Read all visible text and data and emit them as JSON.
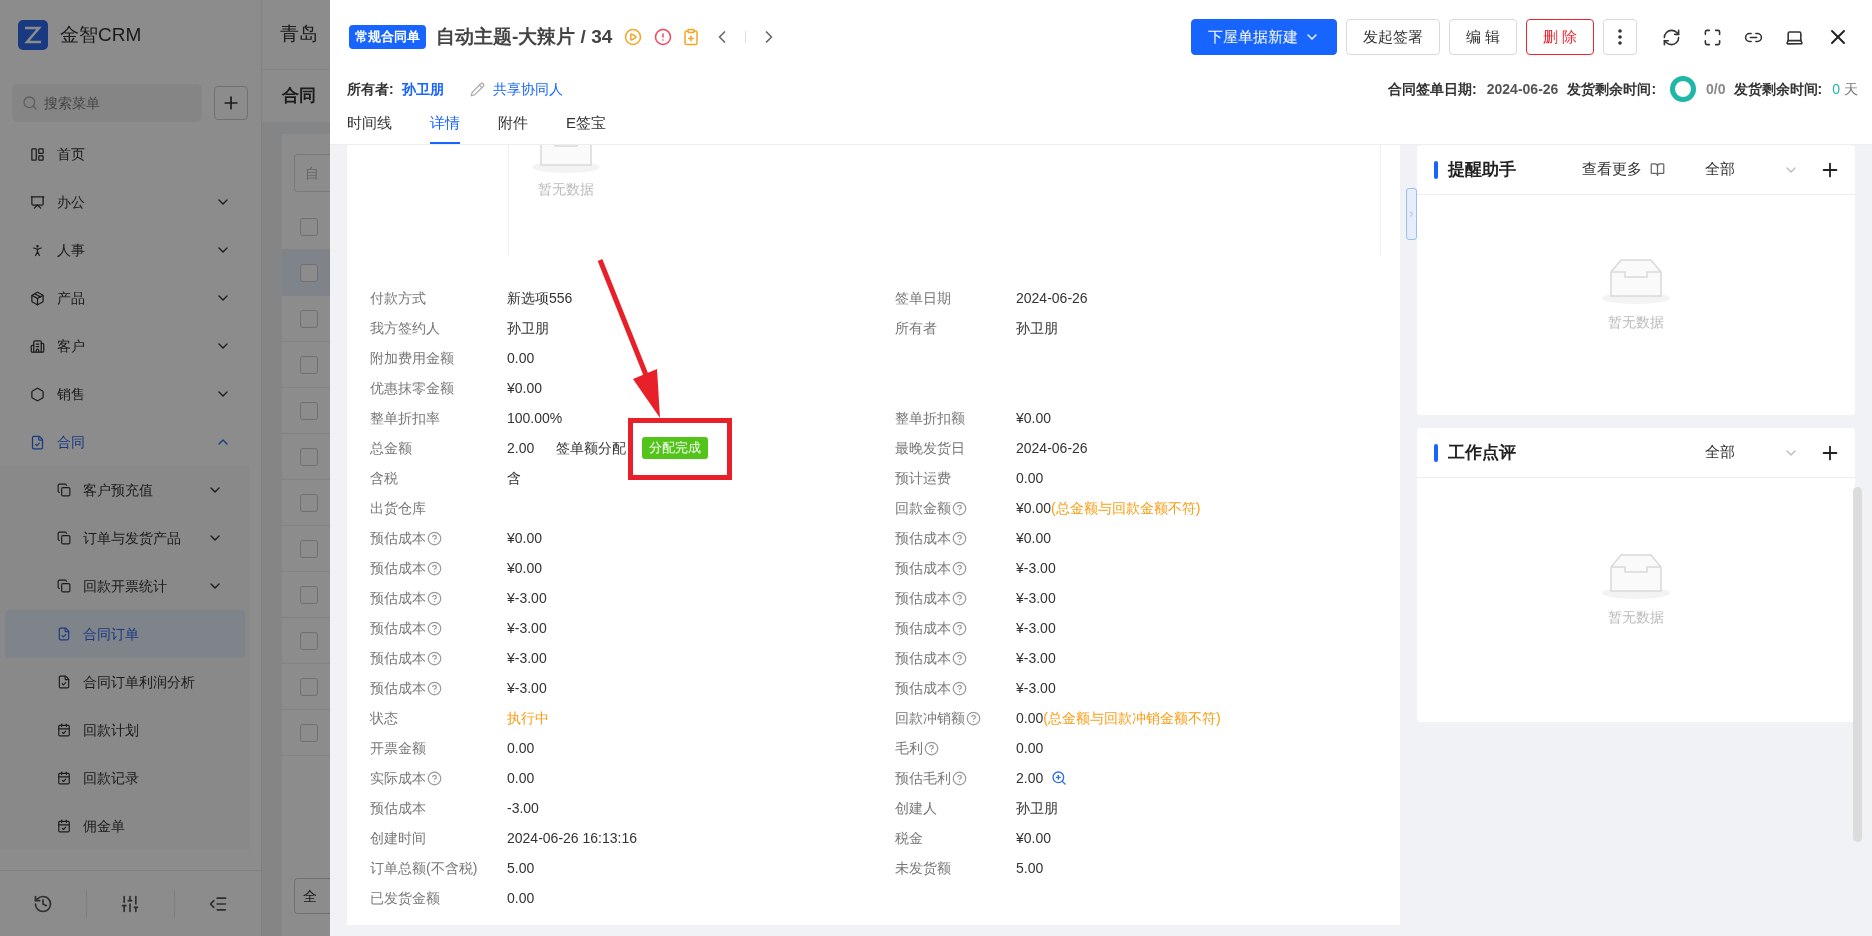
{
  "app": {
    "logo_text": "金智CRM",
    "search_placeholder": "搜索菜单"
  },
  "sidebar": {
    "items": [
      {
        "label": "首页",
        "selected": false
      },
      {
        "label": "办公",
        "selected": false,
        "expanded": false
      },
      {
        "label": "人事",
        "selected": false,
        "expanded": false
      },
      {
        "label": "产品",
        "selected": false,
        "expanded": false
      },
      {
        "label": "客户",
        "selected": false,
        "expanded": false
      },
      {
        "label": "销售",
        "selected": false,
        "expanded": false
      },
      {
        "label": "合同",
        "selected": true,
        "expanded": true,
        "children": [
          {
            "label": "客户预充值",
            "selected": false,
            "expanded": false
          },
          {
            "label": "订单与发货产品",
            "selected": false,
            "expanded": false
          },
          {
            "label": "回款开票统计",
            "selected": false,
            "expanded": false
          },
          {
            "label": "合同订单",
            "selected": true
          },
          {
            "label": "合同订单利润分析",
            "selected": false
          },
          {
            "label": "回款计划",
            "selected": false
          },
          {
            "label": "回款记录",
            "selected": false
          },
          {
            "label": "佣金单",
            "selected": false
          }
        ]
      }
    ]
  },
  "background": {
    "title": "青岛",
    "page_title": "合同",
    "filter_placeholder": "自",
    "footer_button": "全",
    "rows": [
      {
        "checked": false,
        "selected": false
      },
      {
        "checked": false,
        "selected": true
      },
      {
        "checked": false,
        "selected": false
      },
      {
        "checked": false,
        "selected": false
      },
      {
        "checked": false,
        "selected": false
      },
      {
        "checked": false,
        "selected": false
      },
      {
        "checked": false,
        "selected": false
      },
      {
        "checked": false,
        "selected": false
      },
      {
        "checked": false,
        "selected": false
      },
      {
        "checked": false,
        "selected": false
      },
      {
        "checked": false,
        "selected": false
      },
      {
        "checked": false,
        "selected": false
      }
    ]
  },
  "drawer": {
    "badge": "常规合同单",
    "title": "自动主题-大辣片 / 34",
    "actions": [
      {
        "label": "下屋单据新建",
        "kind": "primary"
      },
      {
        "label": "发起签署",
        "kind": "default"
      },
      {
        "label": "编 辑",
        "kind": "default"
      },
      {
        "label": "删 除",
        "kind": "danger"
      }
    ],
    "owner_label": "所有者:",
    "owner": "孙卫朋",
    "share_link": "共享协同人",
    "sign_date_label": "合同签单日期:",
    "sign_date": "2024-06-26",
    "ship_time_label": "发货剩余时间:",
    "ship_progress": "0/0",
    "ship_ring": {
      "level": 1
    },
    "remaining_label": "发货剩余时间:",
    "remaining_value": "0",
    "remaining_unit": "天",
    "tabs": [
      {
        "label": "时间线",
        "selected": false
      },
      {
        "label": "详情",
        "selected": true
      },
      {
        "label": "附件",
        "selected": false
      },
      {
        "label": "E签宝",
        "selected": false
      }
    ]
  },
  "details": {
    "empty_text": "暂无数据",
    "rows": [
      {
        "left": {
          "kind": "text",
          "label": "付款方式",
          "help": false,
          "value": "新选项556"
        },
        "right": {
          "kind": "text",
          "label": "签单日期",
          "help": false,
          "value": "2024-06-26"
        }
      },
      {
        "left": {
          "kind": "text",
          "label": "我方签约人",
          "help": false,
          "value": "孙卫朋"
        },
        "right": {
          "kind": "text",
          "label": "所有者",
          "help": false,
          "value": "孙卫朋"
        }
      },
      {
        "left": {
          "kind": "text",
          "label": "附加费用金额",
          "help": false,
          "value": "0.00"
        }
      },
      {
        "left": {
          "kind": "text",
          "label": "优惠抹零金额",
          "help": false,
          "value": "¥0.00"
        }
      },
      {
        "left": {
          "kind": "text",
          "label": "整单折扣率",
          "help": false,
          "value": "100.00%"
        },
        "right": {
          "kind": "text",
          "label": "整单折扣额",
          "help": false,
          "value": "¥0.00"
        }
      },
      {
        "left": {
          "kind": "allocation",
          "label": "总金额",
          "help": false,
          "value": "2.00",
          "extra": "签单额分配",
          "tag": "分配完成"
        },
        "right": {
          "kind": "text",
          "label": "最晚发货日",
          "help": false,
          "value": "2024-06-26"
        }
      },
      {
        "left": {
          "kind": "text",
          "label": "含税",
          "help": false,
          "value": "含"
        },
        "right": {
          "kind": "text",
          "label": "预计运费",
          "help": false,
          "value": "0.00"
        }
      },
      {
        "left": {
          "kind": "text",
          "label": "出货仓库",
          "help": false
        },
        "right": {
          "kind": "warning",
          "label": "回款金额",
          "help": true,
          "value": "¥0.00",
          "note": "(总金额与回款金额不符)"
        }
      },
      {
        "left": {
          "kind": "text",
          "label": "预估成本",
          "help": true,
          "value": "¥0.00"
        },
        "right": {
          "kind": "text",
          "label": "预估成本",
          "help": true,
          "value": "¥0.00"
        }
      },
      {
        "left": {
          "kind": "text",
          "label": "预估成本",
          "help": true,
          "value": "¥0.00"
        },
        "right": {
          "kind": "text",
          "label": "预估成本",
          "help": true,
          "value": "¥-3.00"
        }
      },
      {
        "left": {
          "kind": "text",
          "label": "预估成本",
          "help": true,
          "value": "¥-3.00"
        },
        "right": {
          "kind": "text",
          "label": "预估成本",
          "help": true,
          "value": "¥-3.00"
        }
      },
      {
        "left": {
          "kind": "text",
          "label": "预估成本",
          "help": true,
          "value": "¥-3.00"
        },
        "right": {
          "kind": "text",
          "label": "预估成本",
          "help": true,
          "value": "¥-3.00"
        }
      },
      {
        "left": {
          "kind": "text",
          "label": "预估成本",
          "help": true,
          "value": "¥-3.00"
        },
        "right": {
          "kind": "text",
          "label": "预估成本",
          "help": true,
          "value": "¥-3.00"
        }
      },
      {
        "left": {
          "kind": "text",
          "label": "预估成本",
          "help": true,
          "value": "¥-3.00"
        },
        "right": {
          "kind": "text",
          "label": "预估成本",
          "help": true,
          "value": "¥-3.00"
        }
      },
      {
        "left": {
          "kind": "status",
          "label": "状态",
          "help": false,
          "value": "执行中"
        },
        "right": {
          "kind": "warning",
          "label": "回款冲销额",
          "help": true,
          "value": "0.00",
          "note": "(总金额与回款冲销金额不符)"
        }
      },
      {
        "left": {
          "kind": "text",
          "label": "开票金额",
          "help": false,
          "value": "0.00"
        },
        "right": {
          "kind": "text",
          "label": "毛利",
          "help": true,
          "value": "0.00"
        }
      },
      {
        "left": {
          "kind": "text",
          "label": "实际成本",
          "help": true,
          "value": "0.00"
        },
        "right": {
          "kind": "zoom",
          "label": "预估毛利",
          "help": true,
          "value": "2.00"
        }
      },
      {
        "left": {
          "kind": "text",
          "label": "预估成本",
          "help": false,
          "value": "-3.00"
        },
        "right": {
          "kind": "text",
          "label": "创建人",
          "help": false,
          "value": "孙卫朋"
        }
      },
      {
        "left": {
          "kind": "text",
          "label": "创建时间",
          "help": false,
          "value": "2024-06-26 16:13:16"
        },
        "right": {
          "kind": "text",
          "label": "税金",
          "help": false,
          "value": "¥0.00"
        }
      },
      {
        "left": {
          "kind": "text",
          "label": "订单总额(不含税)",
          "help": false,
          "value": "5.00"
        },
        "right": {
          "kind": "text",
          "label": "未发货额",
          "help": false,
          "value": "5.00"
        }
      },
      {
        "left": {
          "kind": "text",
          "label": "已发货金额",
          "help": false,
          "value": "0.00"
        }
      }
    ]
  },
  "side_panels": [
    {
      "title": "提醒助手",
      "more_link": "查看更多",
      "filter": "全部",
      "empty_text": "暂无数据"
    },
    {
      "title": "工作点评",
      "filter": "全部",
      "empty_text": "暂无数据"
    }
  ]
}
